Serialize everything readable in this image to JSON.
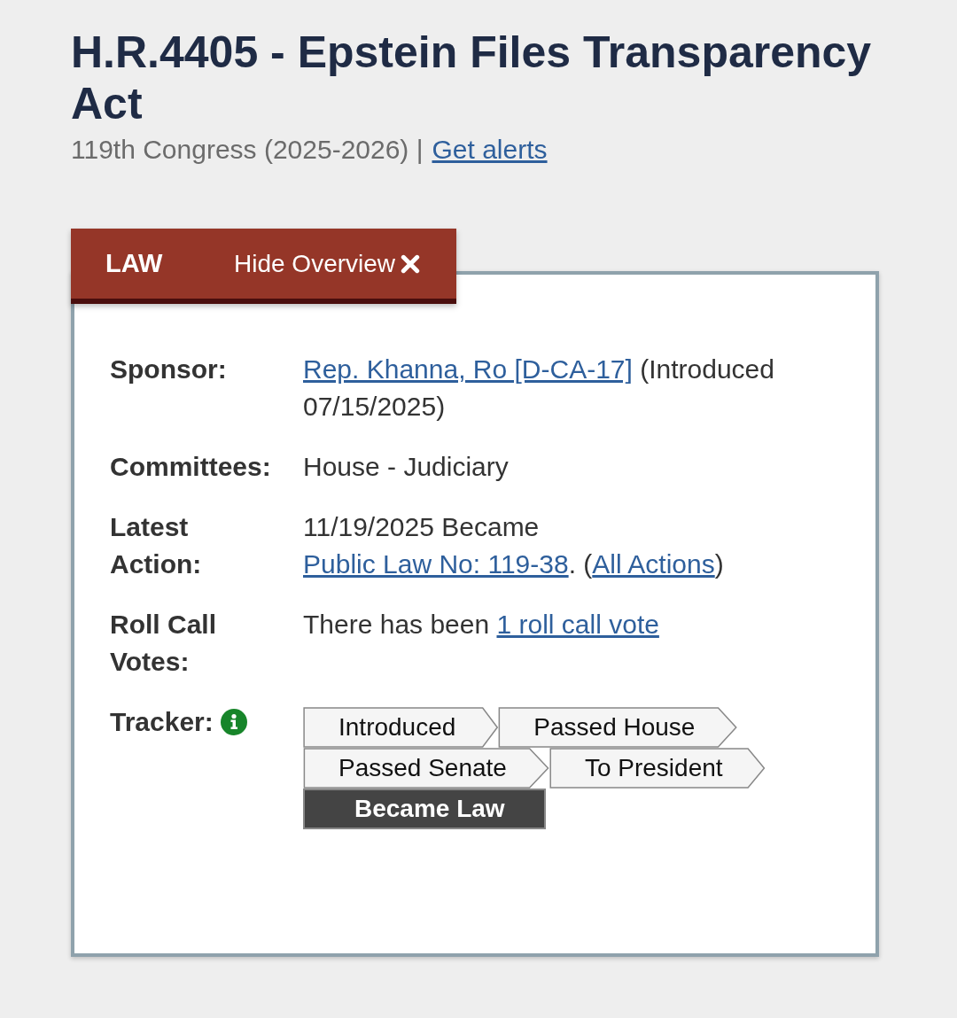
{
  "title": "H.R.4405 - Epstein Files Transparency Act",
  "subtitle": {
    "text": "119th Congress (2025-2026) |",
    "link": "Get alerts"
  },
  "tab_bar": {
    "status": "LAW",
    "toggle": "Hide Overview"
  },
  "overview": [
    {
      "label": "Sponsor:",
      "parts": [
        {
          "kind": "link",
          "text": "Rep. Khanna, Ro [D-CA-17]"
        },
        {
          "kind": "text",
          "text": " (Introduced 07/15/2025)"
        }
      ]
    },
    {
      "label": "Committees:",
      "parts": [
        {
          "kind": "text",
          "text": "House - Judiciary"
        }
      ]
    },
    {
      "label": "Latest Action:",
      "parts": [
        {
          "kind": "text",
          "text": "11/19/2025 Became "
        },
        {
          "kind": "link",
          "text": "Public Law No: 119-38"
        },
        {
          "kind": "text",
          "text": ".  ("
        },
        {
          "kind": "link",
          "text": "All Actions"
        },
        {
          "kind": "text",
          "text": ")"
        }
      ]
    },
    {
      "label": "Roll Call Votes:",
      "parts": [
        {
          "kind": "text",
          "text": "There has been "
        },
        {
          "kind": "link",
          "text": "1 roll call vote"
        }
      ]
    }
  ],
  "tracker": {
    "label": "Tracker:",
    "steps": [
      {
        "label": "Introduced",
        "selected": false
      },
      {
        "label": "Passed House",
        "selected": false
      },
      {
        "label": "Passed Senate",
        "selected": false
      },
      {
        "label": "To President",
        "selected": false
      },
      {
        "label": "Became Law",
        "selected": true
      }
    ]
  }
}
